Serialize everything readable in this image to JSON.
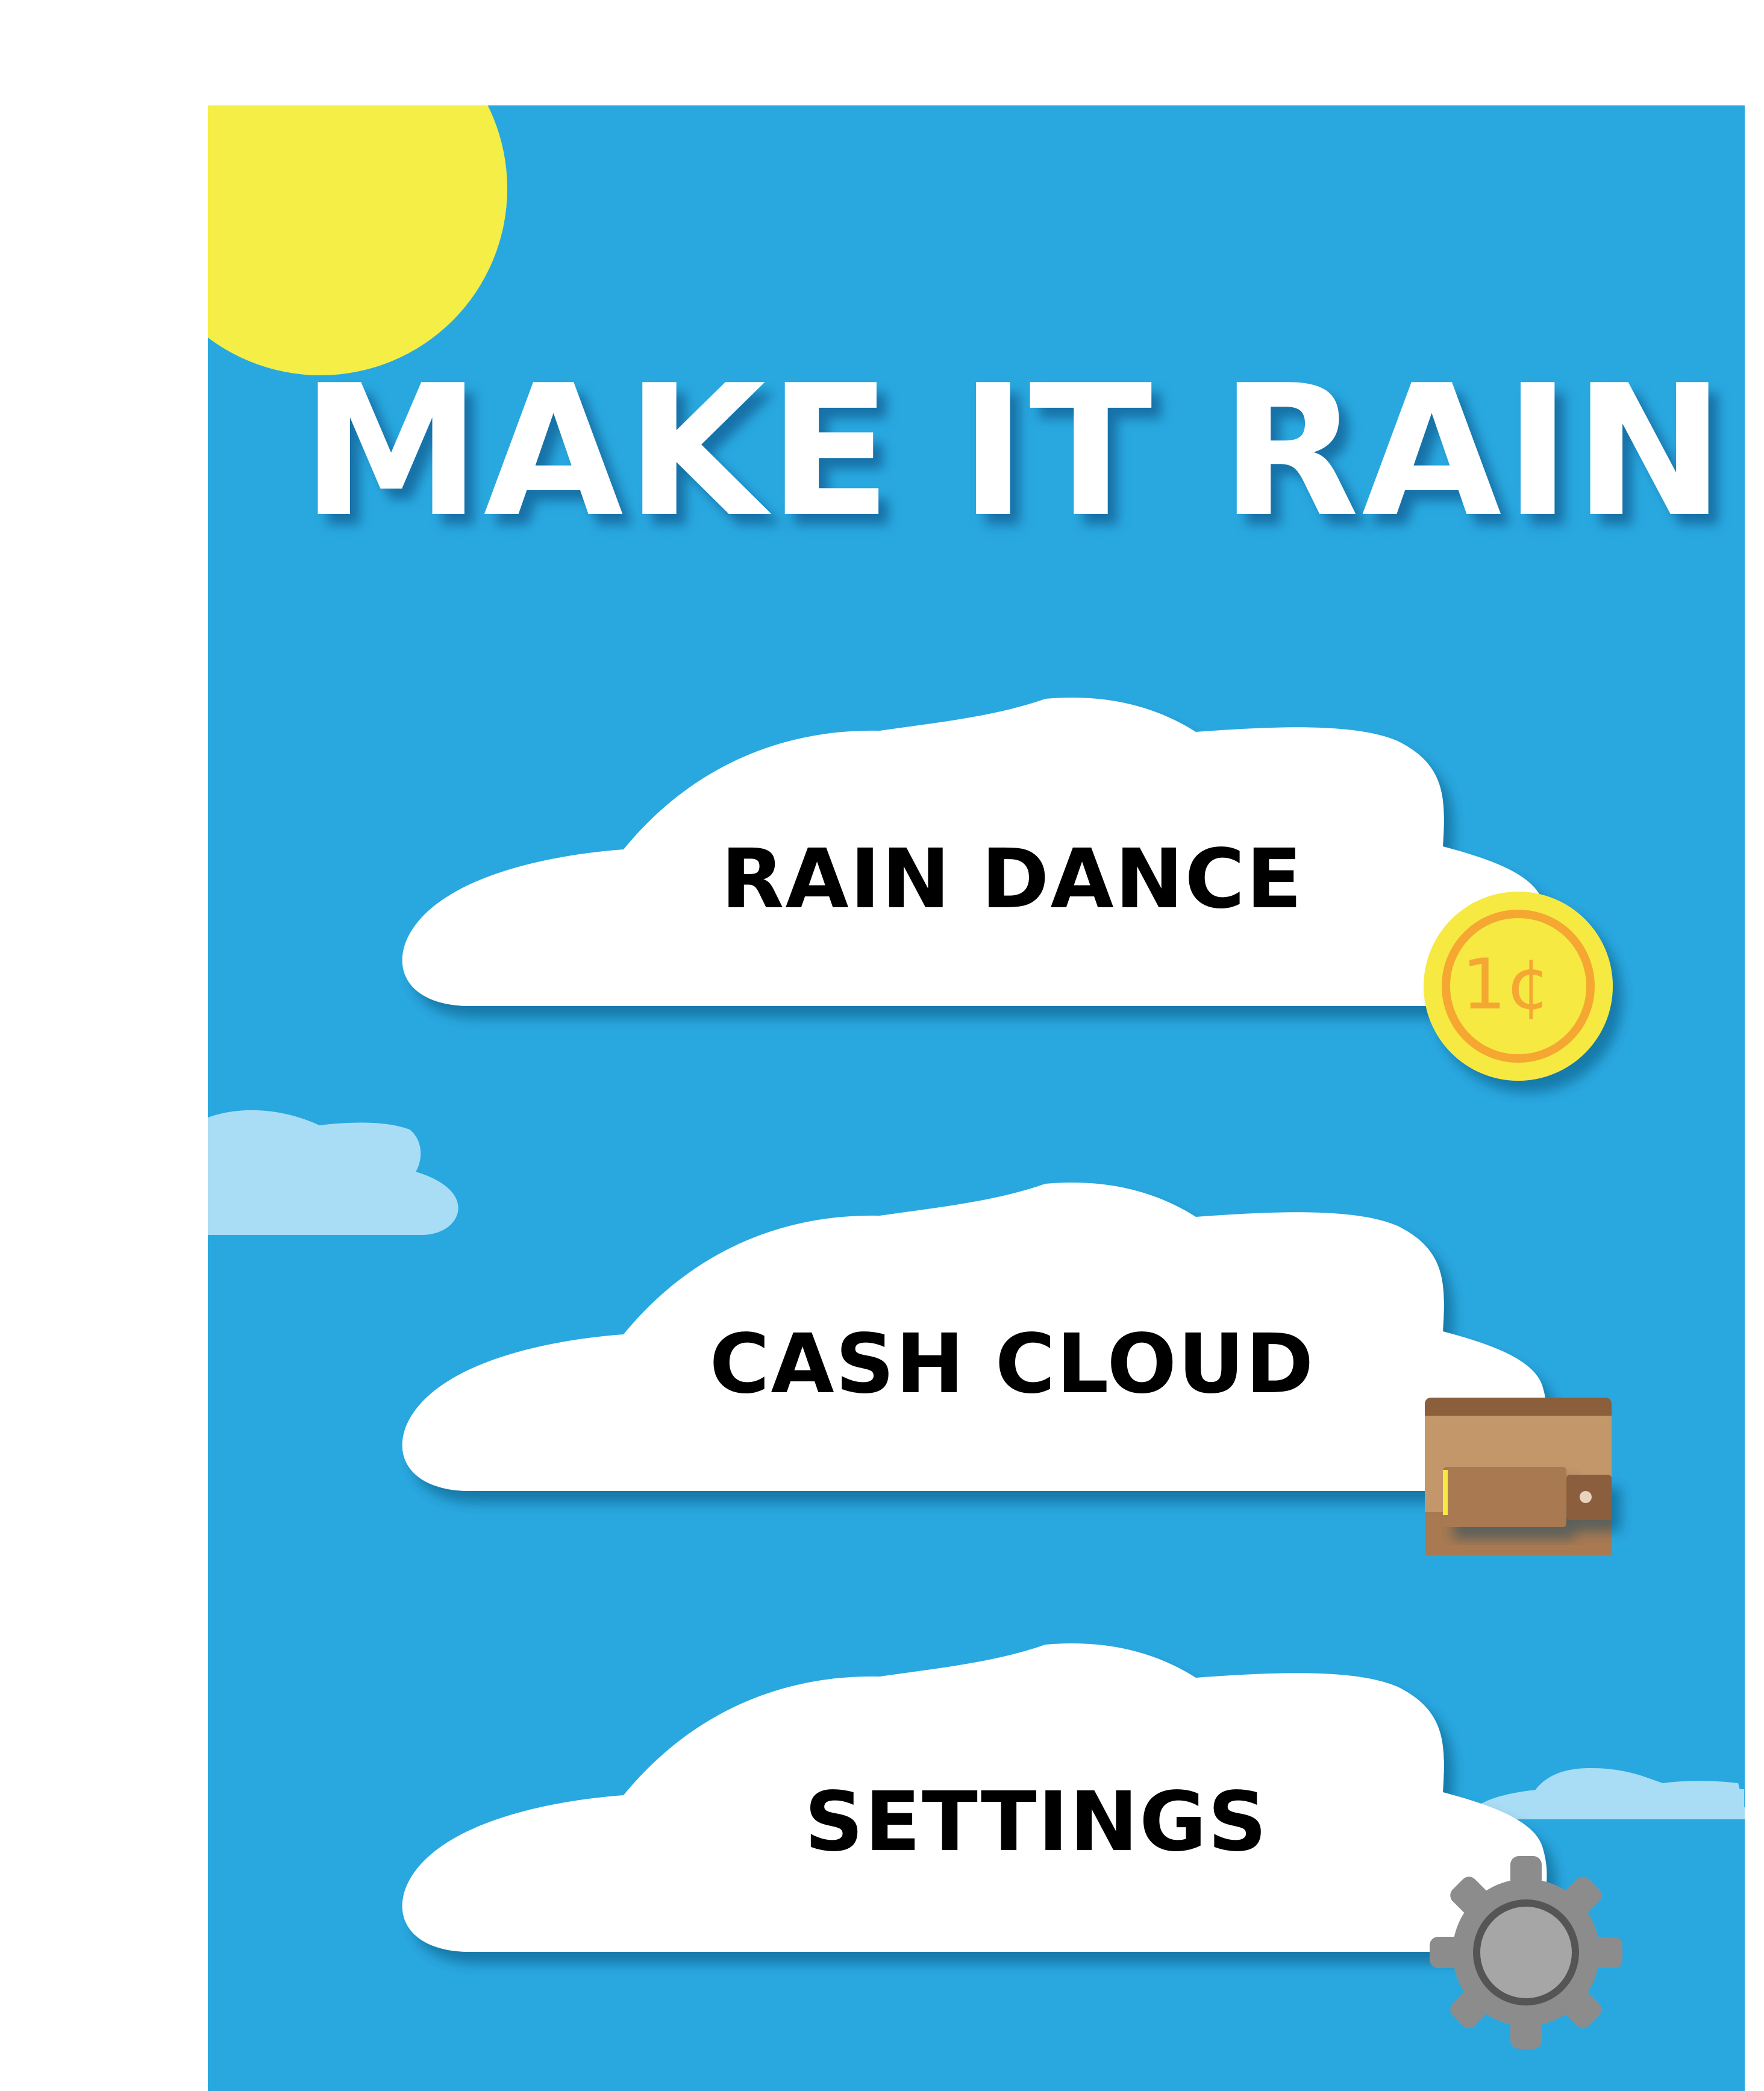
{
  "app": {
    "title": "MAKE IT RAIN"
  },
  "menu": {
    "items": [
      {
        "id": "rain-dance",
        "label": "RAIN DANCE",
        "icon": "coin-icon"
      },
      {
        "id": "cash-cloud",
        "label": "CASH CLOUD",
        "icon": "wallet-icon"
      },
      {
        "id": "settings",
        "label": "SETTINGS",
        "icon": "gear-icon"
      }
    ]
  },
  "coin": {
    "label": "1¢"
  },
  "colors": {
    "sky": "#29a8e0",
    "sun": "#f5ee47",
    "cloud": "#ffffff",
    "small_cloud": "#a9ddf5",
    "coin": "#f6ea42",
    "coin_ring": "#f5a733",
    "wallet": "#8b5e3c",
    "gear": "#8c8c8c"
  }
}
